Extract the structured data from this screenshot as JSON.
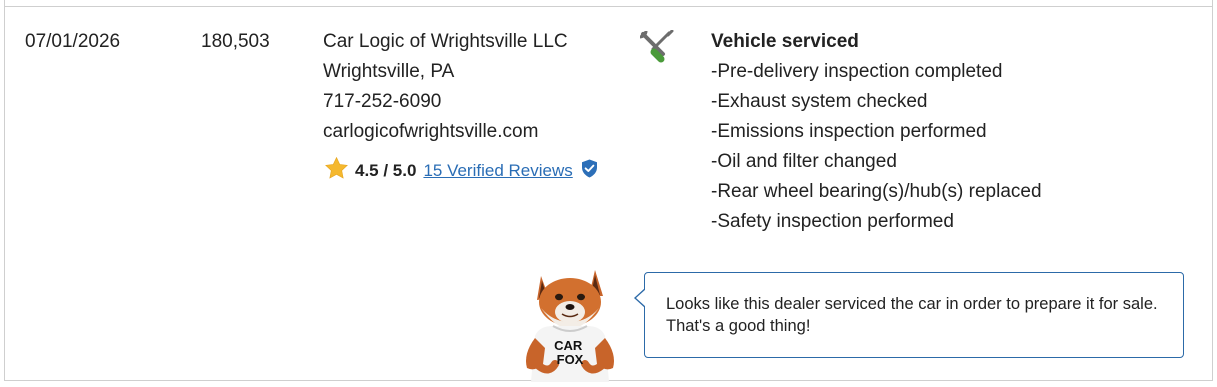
{
  "record": {
    "date": "07/01/2026",
    "odometer": "180,503",
    "dealer": {
      "name": "Car Logic of Wrightsville LLC",
      "location": "Wrightsville, PA",
      "phone": "717-252-6090",
      "website": "carlogicofwrightsville.com"
    },
    "rating": {
      "score": "4.5 / 5.0",
      "reviews_link": "15 Verified Reviews",
      "star_icon": "star-icon",
      "badge_icon": "verified-shield-icon"
    },
    "service_icon": "wrench-screwdriver-icon",
    "details": {
      "heading": "Vehicle serviced",
      "items": [
        "Pre-delivery inspection completed",
        "Exhaust system checked",
        "Emissions inspection performed",
        "Oil and filter changed",
        "Rear wheel bearing(s)/hub(s) replaced",
        "Safety inspection performed"
      ],
      "bullet": "-"
    }
  },
  "tip": {
    "mascot_text": [
      "CAR",
      "FOX"
    ],
    "message": "Looks like this dealer serviced the car in order to prepare it for sale. That's a good thing!"
  },
  "colors": {
    "link": "#2a6db5",
    "bubble_border": "#2c6aa8",
    "star": "#f5b82e",
    "badge": "#2c6fb8",
    "tool_green": "#4a9a3a",
    "tool_gray": "#6d6d6d",
    "border": "#cfcfcf"
  }
}
